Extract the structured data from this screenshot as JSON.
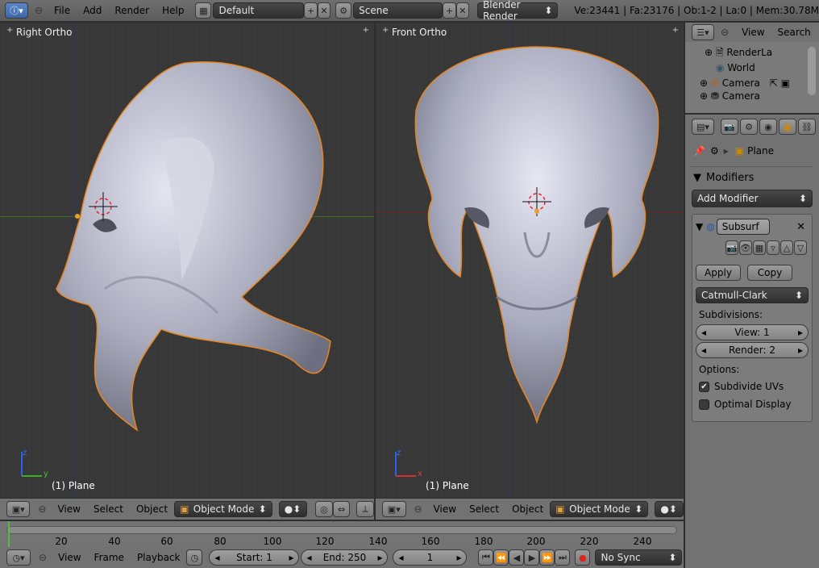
{
  "top_bar": {
    "menus": [
      "File",
      "Add",
      "Render",
      "Help"
    ],
    "screen_layout": "Default",
    "scene": "Scene",
    "render_engine": "Blender Render",
    "stats": "Ve:23441 | Fa:23176 | Ob:1-2 | La:0 | Mem:30.78M"
  },
  "viewport_left": {
    "label": "Right Ortho",
    "object": "(1) Plane",
    "axis_labels": [
      "z",
      "y"
    ]
  },
  "viewport_right": {
    "label": "Front Ortho",
    "object": "(1) Plane",
    "axis_labels": [
      "z",
      "x"
    ]
  },
  "viewport_header": {
    "menus": [
      "View",
      "Select",
      "Object"
    ],
    "mode": "Object Mode"
  },
  "outliner": {
    "menus": [
      "View",
      "Search"
    ],
    "items": [
      "RenderLa",
      "World",
      "Camera",
      "Camera"
    ]
  },
  "properties": {
    "context_object": "Plane",
    "section": "Modifiers",
    "add_modifier": "Add Modifier",
    "modifier_name": "Subsurf",
    "apply": "Apply",
    "copy": "Copy",
    "subdivision_type": "Catmull-Clark",
    "subdivisions_label": "Subdivisions:",
    "view_levels": "View: 1",
    "render_levels": "Render: 2",
    "options_label": "Options:",
    "subdivide_uvs": "Subdivide UVs",
    "subdivide_uvs_checked": true,
    "optimal_display": "Optimal Display",
    "optimal_display_checked": false
  },
  "timeline": {
    "ticks": [
      "20",
      "40",
      "60",
      "80",
      "100",
      "120",
      "140",
      "160",
      "180",
      "200",
      "220",
      "240"
    ],
    "menus": [
      "View",
      "Frame",
      "Playback"
    ],
    "start": "Start: 1",
    "end": "End: 250",
    "current": "1",
    "sync": "No Sync"
  },
  "colors": {
    "selection_outline": "#e8861e",
    "mesh": "#b4b6c8",
    "grid_x": "#6b2a2a",
    "grid_y": "#3c6b24"
  }
}
